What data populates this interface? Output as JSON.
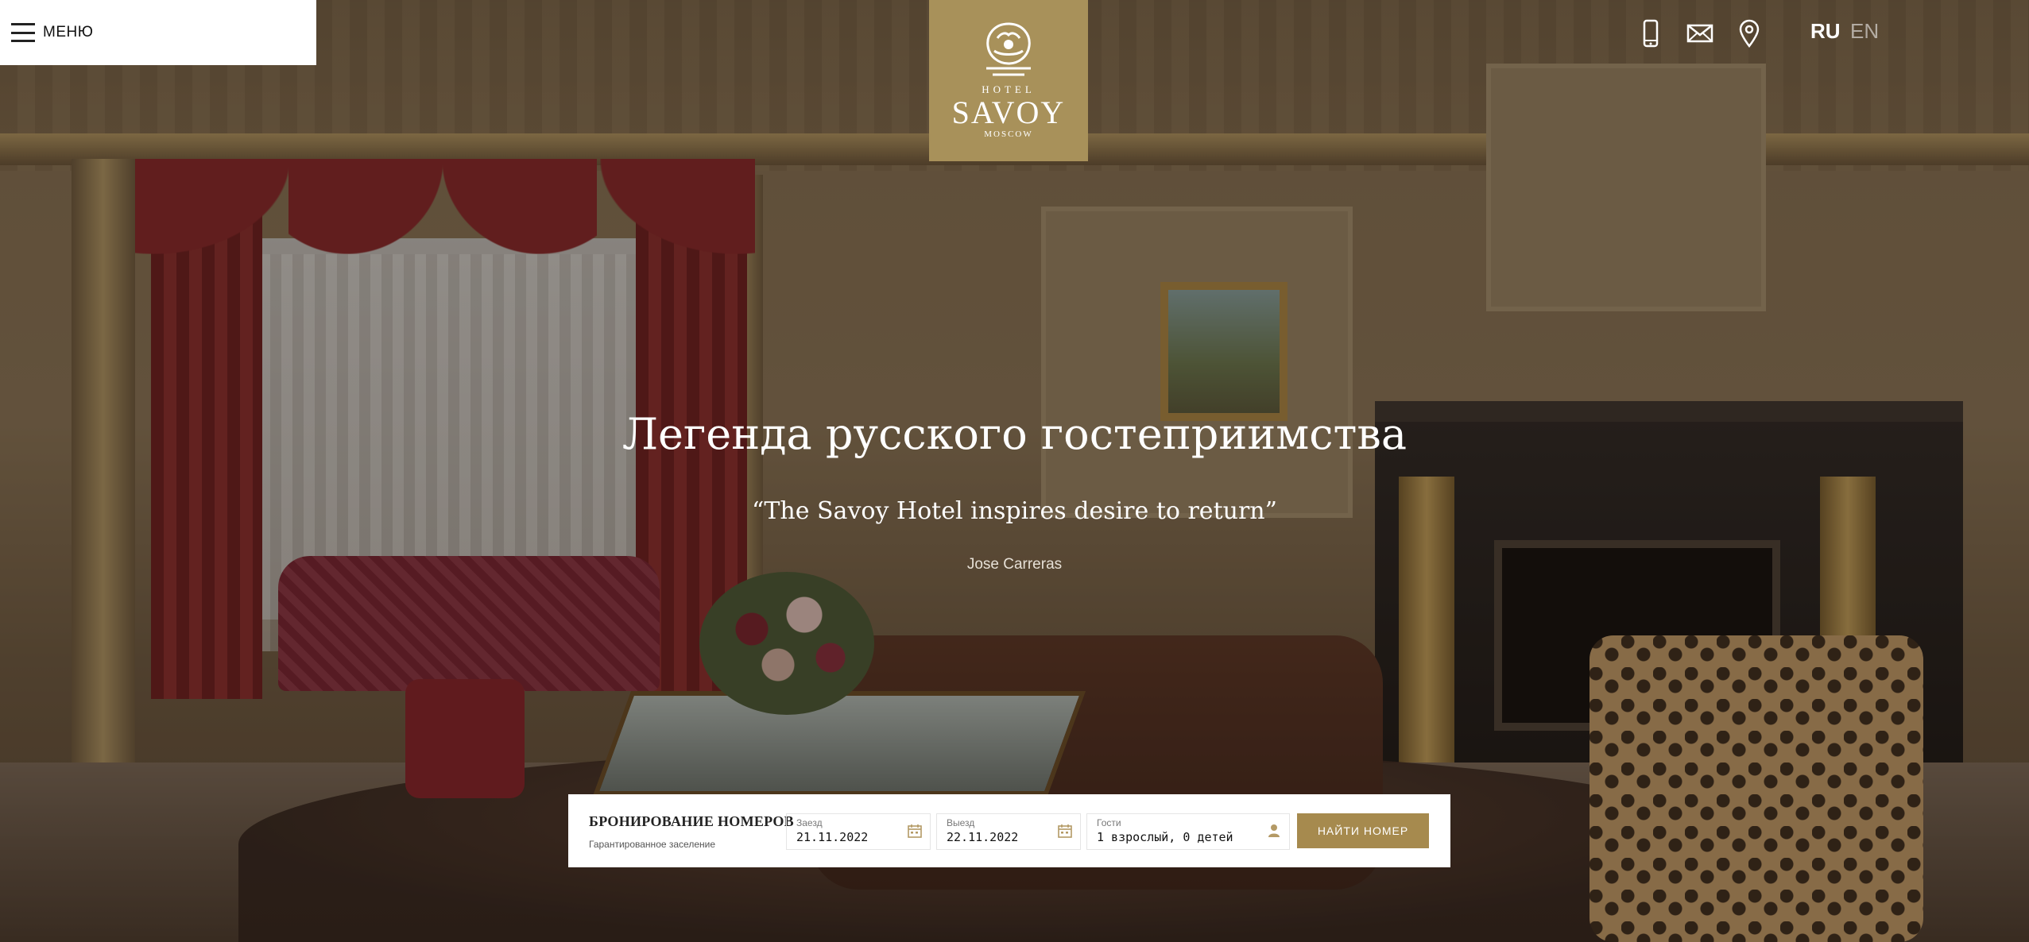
{
  "header": {
    "menu_label": "МЕНЮ",
    "logo": {
      "hotel": "HOTEL",
      "name": "SAVOY",
      "city": "MOSCOW"
    },
    "icons": [
      "phone-icon",
      "mail-icon",
      "location-icon"
    ],
    "languages": [
      {
        "code": "RU",
        "active": true
      },
      {
        "code": "EN",
        "active": false
      }
    ]
  },
  "hero": {
    "title": "Легенда русского гостеприимства",
    "quote": "“The Savoy Hotel inspires desire to return”",
    "author": "Jose Carreras"
  },
  "booking": {
    "title": "БРОНИРОВАНИЕ НОМЕРОВ",
    "subtitle": "Гарантированное заселение",
    "checkin": {
      "label": "Заезд",
      "value": "21.11.2022"
    },
    "checkout": {
      "label": "Выезд",
      "value": "22.11.2022"
    },
    "guests": {
      "label": "Гости",
      "value": "1 взрослый, 0 детей"
    },
    "button": "НАЙТИ НОМЕР"
  },
  "colors": {
    "gold": "#a8915a",
    "button": "#a68a4e",
    "white": "#ffffff"
  }
}
